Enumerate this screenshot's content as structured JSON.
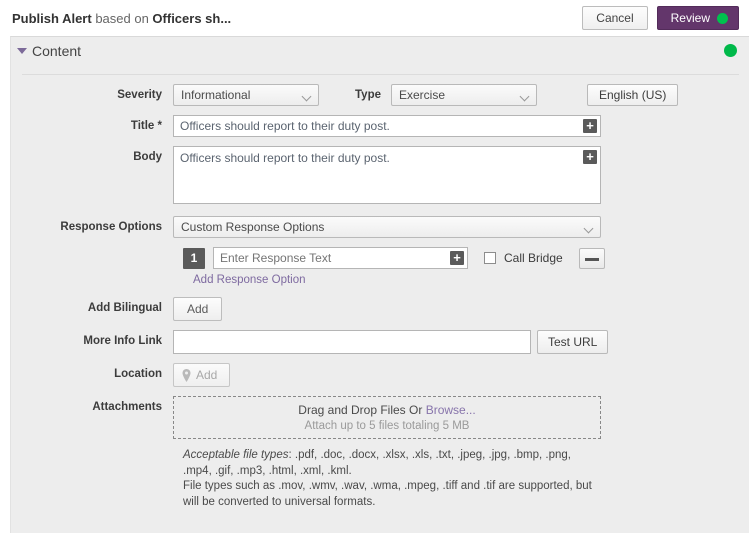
{
  "topbar": {
    "title_strong_1": "Publish Alert",
    "title_mid": " based on ",
    "title_strong_2": "Officers sh...",
    "cancel_label": "Cancel",
    "review_label": "Review",
    "review_dot_color": "#00c14e",
    "review_bg_color": "#63366b"
  },
  "panel": {
    "title": "Content",
    "status_dot_color": "#00b94a",
    "caret_icon": "caret-down-icon"
  },
  "form": {
    "severity": {
      "label": "Severity",
      "value": "Informational"
    },
    "type": {
      "label": "Type",
      "value": "Exercise"
    },
    "language_button": {
      "label": "English (US)"
    },
    "title_field": {
      "label": "Title *",
      "value": "Officers should report to their duty post.",
      "placeholder": ""
    },
    "body_field": {
      "label": "Body",
      "value": "Officers should report to their duty post.",
      "placeholder": ""
    },
    "response_options": {
      "label": "Response Options",
      "value": "Custom Response Options",
      "option_number": "1",
      "option_placeholder": "Enter Response Text",
      "option_value": "",
      "call_bridge_label": "Call Bridge",
      "add_link_label": "Add Response Option"
    },
    "add_bilingual": {
      "label": "Add Bilingual",
      "button_label": "Add"
    },
    "more_info_link": {
      "label": "More Info Link",
      "value": "",
      "placeholder": "",
      "test_button_label": "Test URL"
    },
    "location": {
      "label": "Location",
      "button_label": "Add"
    },
    "attachments": {
      "label": "Attachments",
      "drop_text_prefix": "Drag and Drop Files Or ",
      "browse_label": "Browse...",
      "limit_text": "Attach up to 5 files totaling 5 MB",
      "filetypes_italic": "Acceptable file types",
      "filetypes_rest": ": .pdf, .doc, .docx, .xlsx, .xls, .txt, .jpeg, .jpg, .bmp, .png, .mp4, .gif, .mp3, .html, .xml, .kml.",
      "filetypes_note": "File types such as .mov, .wmv, .wav, .wma, .mpeg, .tiff and .tif are supported, but will be converted to universal formats."
    }
  }
}
